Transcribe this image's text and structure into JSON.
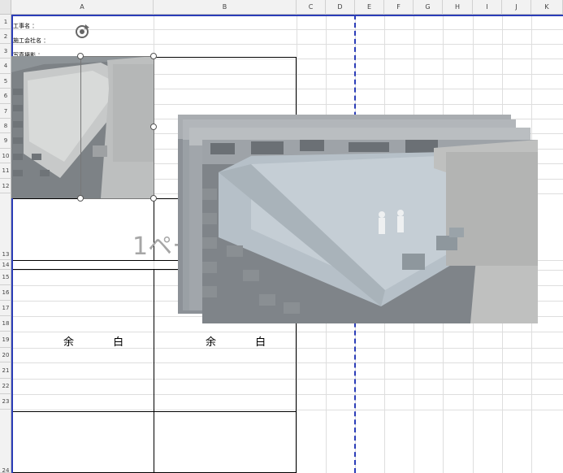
{
  "columns": [
    "A",
    "B",
    "C",
    "D",
    "E",
    "F",
    "G",
    "H",
    "I",
    "J",
    "K"
  ],
  "rows": [
    "1",
    "2",
    "3",
    "4",
    "5",
    "6",
    "7",
    "8",
    "9",
    "10",
    "11",
    "12",
    "13",
    "14",
    "15",
    "16",
    "17",
    "18",
    "19",
    "20",
    "21",
    "22",
    "23",
    "24"
  ],
  "cells": {
    "project_name": "工事名 ：",
    "contractor": "施工会社名 ：",
    "inspection_type": "写真撮影 ："
  },
  "page_watermark": "1ページ",
  "blank_left": "余 白",
  "blank_right": "余 白",
  "colors": {
    "pagebreak": "#2b3db8",
    "header_bg": "#f2f2f2",
    "watermark": "#a6a6a6"
  },
  "icons": {
    "rotate_handle": "rotate-icon"
  }
}
